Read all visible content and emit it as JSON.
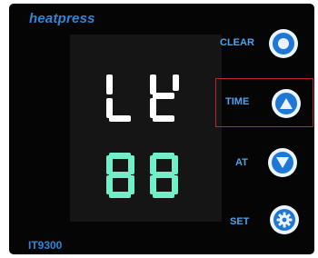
{
  "brand": "heatpress",
  "model": "IT9300",
  "display": {
    "top_readout": "Lt",
    "bottom_readout": "88",
    "top_color": "#ffffff",
    "bottom_color": "#6ff0c8"
  },
  "controls": [
    {
      "label": "CLEAR",
      "icon": "circle-icon"
    },
    {
      "label": "TIME",
      "icon": "up-triangle-icon",
      "highlighted": true
    },
    {
      "label": "AT",
      "icon": "down-triangle-icon"
    },
    {
      "label": "SET",
      "icon": "gear-icon"
    }
  ],
  "colors": {
    "panel": "#050505",
    "label": "#4fa3ec",
    "button": "#1f77d6",
    "highlight": "#c0232b"
  }
}
